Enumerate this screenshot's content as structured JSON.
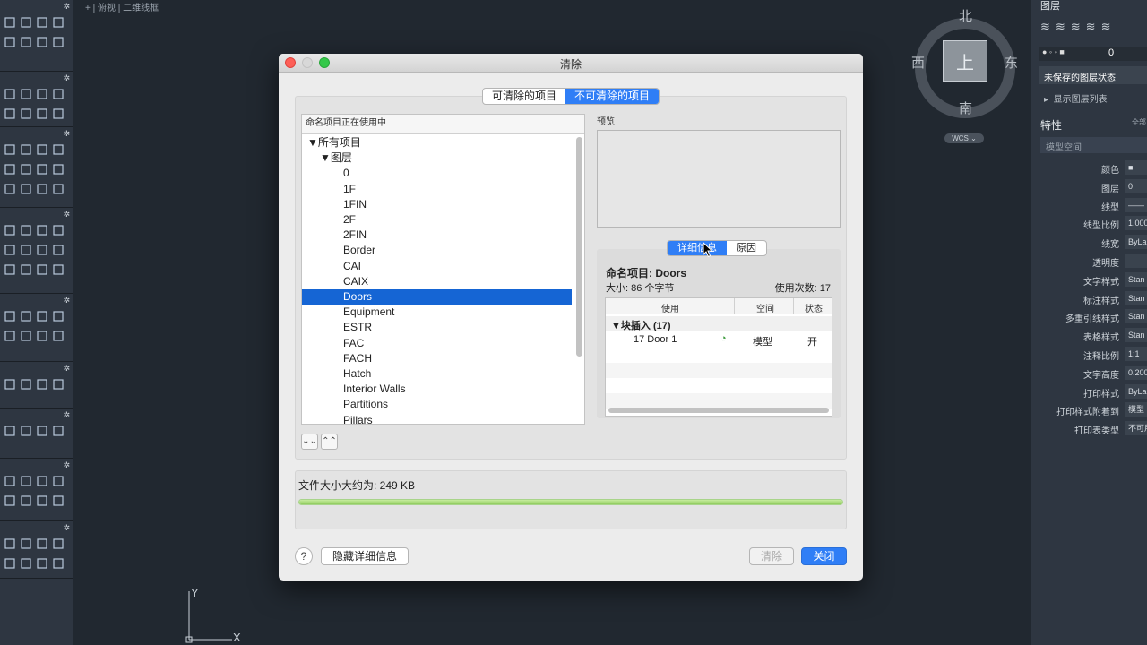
{
  "viewport": {
    "label": "+ | 俯视 | 二维线框",
    "viewcube": {
      "north": "北",
      "south": "南",
      "east": "东",
      "west": "西",
      "top": "上"
    },
    "wcs": "WCS ⌄",
    "ucs": {
      "x": "X",
      "y": "Y"
    }
  },
  "right_panel": {
    "layers_title": "图层",
    "layer_current": "0",
    "unsaved_state": "未保存的图层状态",
    "show_layer_list": "显示图层列表",
    "properties_title": "特性",
    "properties_badge": "全部",
    "space": "模型空间",
    "rows": [
      {
        "label": "颜色",
        "value": "■"
      },
      {
        "label": "图层",
        "value": "0"
      },
      {
        "label": "线型",
        "value": "——"
      },
      {
        "label": "线型比例",
        "value": "1.000"
      },
      {
        "label": "线宽",
        "value": "ByLa"
      },
      {
        "label": "透明度",
        "value": ""
      },
      {
        "label": "文字样式",
        "value": "Stan"
      },
      {
        "label": "标注样式",
        "value": "Stan"
      },
      {
        "label": "多重引线样式",
        "value": "Stan"
      },
      {
        "label": "表格样式",
        "value": "Stan"
      },
      {
        "label": "注释比例",
        "value": "1:1"
      },
      {
        "label": "文字高度",
        "value": "0.200"
      },
      {
        "label": "打印样式",
        "value": "ByLa"
      },
      {
        "label": "打印样式附着到",
        "value": "模型"
      },
      {
        "label": "打印表类型",
        "value": "不可用"
      }
    ]
  },
  "dialog": {
    "title": "清除",
    "tabs": [
      "可清除的项目",
      "不可清除的项目"
    ],
    "active_tab": 1,
    "tree_header": "命名项目正在使用中",
    "tree": [
      {
        "label": "▼所有项目",
        "depth": 0
      },
      {
        "label": "▼图层",
        "depth": 1
      },
      {
        "label": "0",
        "depth": 2
      },
      {
        "label": "1F",
        "depth": 2
      },
      {
        "label": "1FIN",
        "depth": 2
      },
      {
        "label": "2F",
        "depth": 2
      },
      {
        "label": "2FIN",
        "depth": 2
      },
      {
        "label": "Border",
        "depth": 2
      },
      {
        "label": "CAI",
        "depth": 2
      },
      {
        "label": "CAIX",
        "depth": 2
      },
      {
        "label": "Doors",
        "depth": 2,
        "selected": true
      },
      {
        "label": "Equipment",
        "depth": 2
      },
      {
        "label": "ESTR",
        "depth": 2
      },
      {
        "label": "FAC",
        "depth": 2
      },
      {
        "label": "FACH",
        "depth": 2
      },
      {
        "label": "Hatch",
        "depth": 2
      },
      {
        "label": "Interior Walls",
        "depth": 2
      },
      {
        "label": "Partitions",
        "depth": 2
      },
      {
        "label": "Pillars",
        "depth": 2
      }
    ],
    "expand_all": "≫",
    "collapse_all": "≪",
    "preview_label": "预览",
    "detail_tabs": [
      "详细信息",
      "原因"
    ],
    "detail_active": 0,
    "named_item": "命名项目: Doors",
    "size": "大小: 86 个字节",
    "use_count": "使用次数: 17",
    "usage_columns": [
      "使用",
      "空间",
      "状态"
    ],
    "usage_group": "▼块插入 (17)",
    "usage_rows": [
      {
        "name": "17 Door 1",
        "space": "模型",
        "status": "开"
      }
    ],
    "filesize_label": "文件大小大约为: 249 KB",
    "progress": 1.0,
    "help": "?",
    "hide_details": "隐藏详细信息",
    "purge_button": "清除",
    "close_button": "关闭"
  }
}
